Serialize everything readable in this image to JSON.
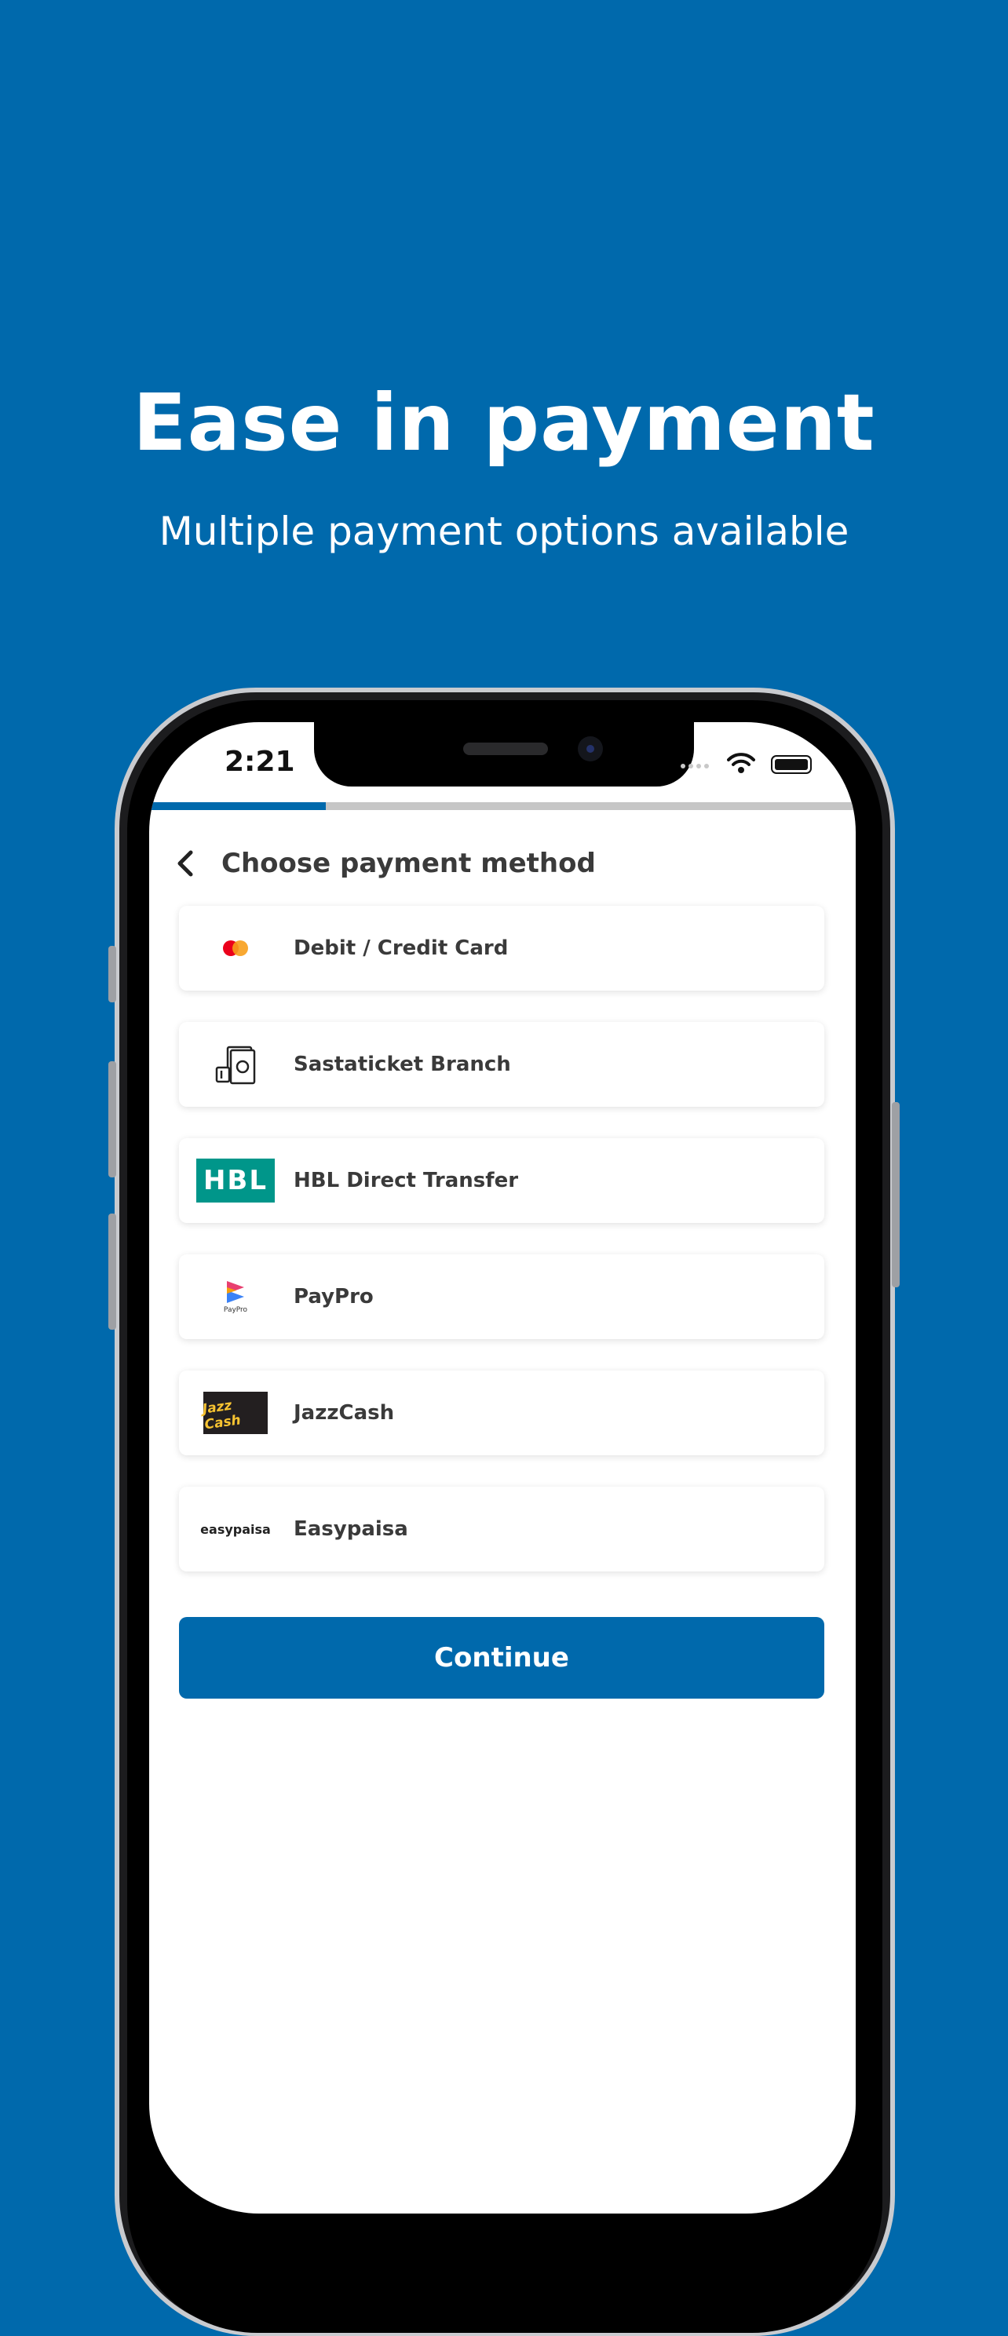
{
  "promo": {
    "title": "Ease in payment",
    "subtitle": "Multiple payment options available"
  },
  "status_bar": {
    "time": "2:21",
    "icons": [
      "signal-icon",
      "wifi-icon",
      "battery-icon"
    ]
  },
  "progress": {
    "value": 0.25,
    "color": "#0069ac"
  },
  "header": {
    "title": "Choose payment method",
    "back_icon": "chevron-left-icon"
  },
  "methods": [
    {
      "label": "Debit / Credit Card",
      "icon": "mastercard-icon"
    },
    {
      "label": "Sastaticket Branch",
      "icon": "cash-icon"
    },
    {
      "label": "HBL Direct Transfer",
      "icon": "hbl-logo",
      "logo_text": "HBL"
    },
    {
      "label": "PayPro",
      "icon": "paypro-logo",
      "logo_text": "PayPro"
    },
    {
      "label": "JazzCash",
      "icon": "jazzcash-logo",
      "logo_text": "Jazz Cash"
    },
    {
      "label": "Easypaisa",
      "icon": "easypaisa-logo",
      "logo_text": "easypaisa"
    }
  ],
  "continue_label": "Continue",
  "colors": {
    "brand": "#0069ac",
    "hbl": "#00968a"
  }
}
